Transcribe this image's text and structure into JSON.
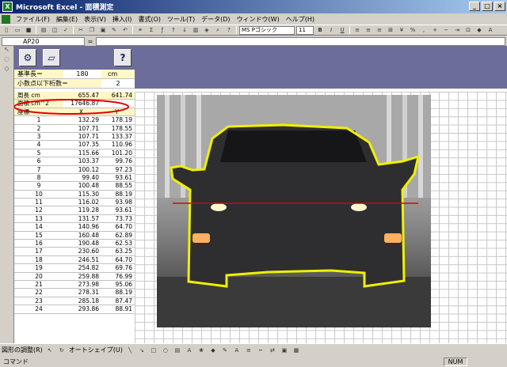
{
  "window": {
    "title": "Microsoft Excel - 面積測定",
    "app_icon": "X"
  },
  "menu": [
    "ファイル(F)",
    "編集(E)",
    "表示(V)",
    "挿入(I)",
    "書式(O)",
    "ツール(T)",
    "データ(D)",
    "ウィンドウ(W)",
    "ヘルプ(H)"
  ],
  "toolbar": {
    "font_name": "MS Pゴシック",
    "font_size": "11"
  },
  "formula_bar": {
    "cell_ref": "AP20",
    "eq": "="
  },
  "settings": {
    "base_label": "基準長＝",
    "base_value": "180",
    "base_unit": "cm",
    "decimals_label": "小数点以下桁数＝",
    "decimals_value": "2"
  },
  "table": {
    "perimeter_label": "周長 cm",
    "perimeter_x": "655.47",
    "perimeter_y": "641.74",
    "area_label": "面積 cm^2",
    "area_value": "17646.87",
    "coord_label": "座標",
    "col_x": "X",
    "col_y": "Y",
    "rows": [
      [
        "1",
        "132.29",
        "178.19"
      ],
      [
        "2",
        "107.71",
        "178.55"
      ],
      [
        "3",
        "107.71",
        "133.37"
      ],
      [
        "4",
        "107.35",
        "110.96"
      ],
      [
        "5",
        "115.66",
        "101.20"
      ],
      [
        "6",
        "103.37",
        "99.76"
      ],
      [
        "7",
        "100.12",
        "97.23"
      ],
      [
        "8",
        "99.40",
        "93.61"
      ],
      [
        "9",
        "100.48",
        "88.55"
      ],
      [
        "10",
        "115.30",
        "88.19"
      ],
      [
        "11",
        "116.02",
        "93.98"
      ],
      [
        "12",
        "119.28",
        "93.61"
      ],
      [
        "13",
        "131.57",
        "73.73"
      ],
      [
        "14",
        "140.96",
        "64.70"
      ],
      [
        "15",
        "160.48",
        "62.89"
      ],
      [
        "16",
        "190.48",
        "62.53"
      ],
      [
        "17",
        "230.60",
        "63.25"
      ],
      [
        "18",
        "246.51",
        "64.70"
      ],
      [
        "19",
        "254.82",
        "69.76"
      ],
      [
        "20",
        "259.88",
        "76.99"
      ],
      [
        "21",
        "273.98",
        "95.06"
      ],
      [
        "22",
        "278.31",
        "88.19"
      ],
      [
        "23",
        "285.18",
        "87.47"
      ],
      [
        "24",
        "293.86",
        "88.91"
      ]
    ]
  },
  "buttons": {
    "help": "?"
  },
  "bottom_toolbar": {
    "draw": "図形の調整(R)",
    "autoshape": "オートシェイプ(U)"
  },
  "status": {
    "text": "コマンド",
    "num": "NUM"
  },
  "colors": {
    "outline": "#f0f000",
    "ellipse": "#e00000",
    "midline": "#e00000",
    "header_band": "#6d6d9b"
  }
}
